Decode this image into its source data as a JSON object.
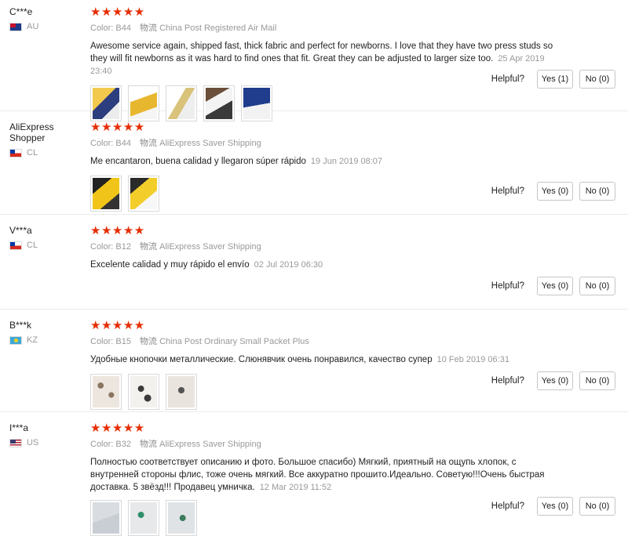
{
  "reviews": [
    {
      "user": "C***e",
      "country": "AU",
      "stars": "★★★★★",
      "color": "Color: B44",
      "shipping_label": "物流",
      "shipping": "China Post Registered Air Mail",
      "text": "Awesome service again, shipped fast, thick fabric and perfect for newborns. I love that they have two press studs so they will fit newborns as it was hard to find ones that fit. Great they can be adjusted to larger size too.",
      "date": "25 Apr 2019 23:40",
      "photos": 5,
      "helpful_label": "Helpful?",
      "yes": "Yes (1)",
      "no": "No (0)"
    },
    {
      "user": "AliExpress Shopper",
      "country": "CL",
      "stars": "★★★★★",
      "color": "Color: B44",
      "shipping_label": "物流",
      "shipping": "AliExpress Saver Shipping",
      "text": "Me encantaron, buena calidad y llegaron súper rápido",
      "date": "19 Jun 2019 08:07",
      "photos": 2,
      "helpful_label": "Helpful?",
      "yes": "Yes (0)",
      "no": "No (0)"
    },
    {
      "user": "V***a",
      "country": "CL",
      "stars": "★★★★★",
      "color": "Color: B12",
      "shipping_label": "物流",
      "shipping": "AliExpress Saver Shipping",
      "text": "Excelente calidad y muy rápido el envío",
      "date": "02 Jul 2019 06:30",
      "photos": 0,
      "helpful_label": "Helpful?",
      "yes": "Yes (0)",
      "no": "No (0)"
    },
    {
      "user": "B***k",
      "country": "KZ",
      "stars": "★★★★★",
      "color": "Color: B15",
      "shipping_label": "物流",
      "shipping": "China Post Ordinary Small Packet Plus",
      "text": "Удобные кнопочки металлические. Слюнявчик очень понравился, качество супер",
      "date": "10 Feb 2019 06:31",
      "photos": 3,
      "helpful_label": "Helpful?",
      "yes": "Yes (0)",
      "no": "No (0)"
    },
    {
      "user": "I***a",
      "country": "US",
      "stars": "★★★★★",
      "color": "Color: B32",
      "shipping_label": "物流",
      "shipping": "AliExpress Saver Shipping",
      "text": "Полностью соответствует описанию и фото. Большое спасибо) Мягкий, приятный на ощупь хлопок, с внутренней стороны флис, тоже очень мягкий. Все аккуратно прошито.Идеально. Советую!!!Очень быстрая доставка. 5 звёзд!!! Продавец умничка.",
      "date": "12 Mar 2019 11:52",
      "photos": 3,
      "helpful_label": "Helpful?",
      "yes": "Yes (0)",
      "no": "No (0)"
    }
  ],
  "colors": {
    "star": "#e62e04",
    "muted": "#999999",
    "border": "#ebebeb"
  }
}
